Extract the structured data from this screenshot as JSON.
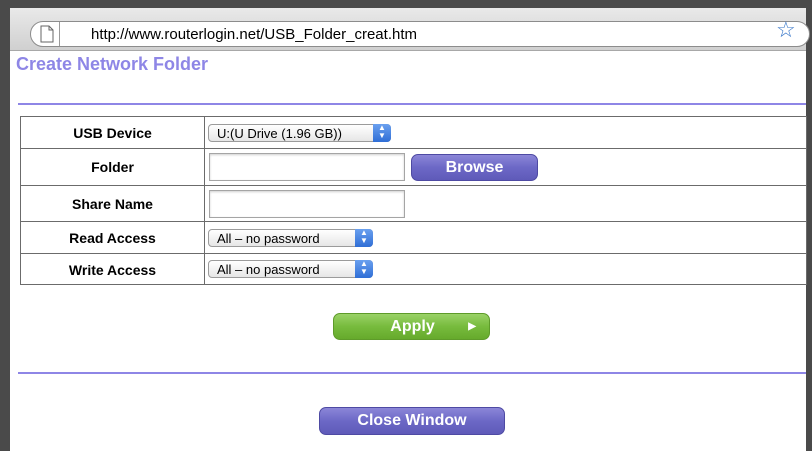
{
  "browser": {
    "url": "http://www.routerlogin.net/USB_Folder_creat.htm"
  },
  "page": {
    "title": "Create Network Folder"
  },
  "form": {
    "usb_device": {
      "label": "USB Device",
      "selected": "U:(U Drive (1.96 GB))"
    },
    "folder": {
      "label": "Folder",
      "value": "",
      "browse_label": "Browse"
    },
    "share_name": {
      "label": "Share Name",
      "value": ""
    },
    "read_access": {
      "label": "Read Access",
      "selected": "All – no password"
    },
    "write_access": {
      "label": "Write Access",
      "selected": "All – no password"
    }
  },
  "actions": {
    "apply_label": "Apply",
    "close_label": "Close Window"
  },
  "colors": {
    "accent_purple": "#8e86e6",
    "button_purple": "#6c68c6",
    "button_green": "#77bb3d",
    "star_blue": "#3a78c9"
  },
  "icons": {
    "page": "page-icon",
    "bookmark": "star-icon",
    "select_arrows": "up-down-arrows-icon",
    "apply_arrow": "play-arrow-icon"
  }
}
